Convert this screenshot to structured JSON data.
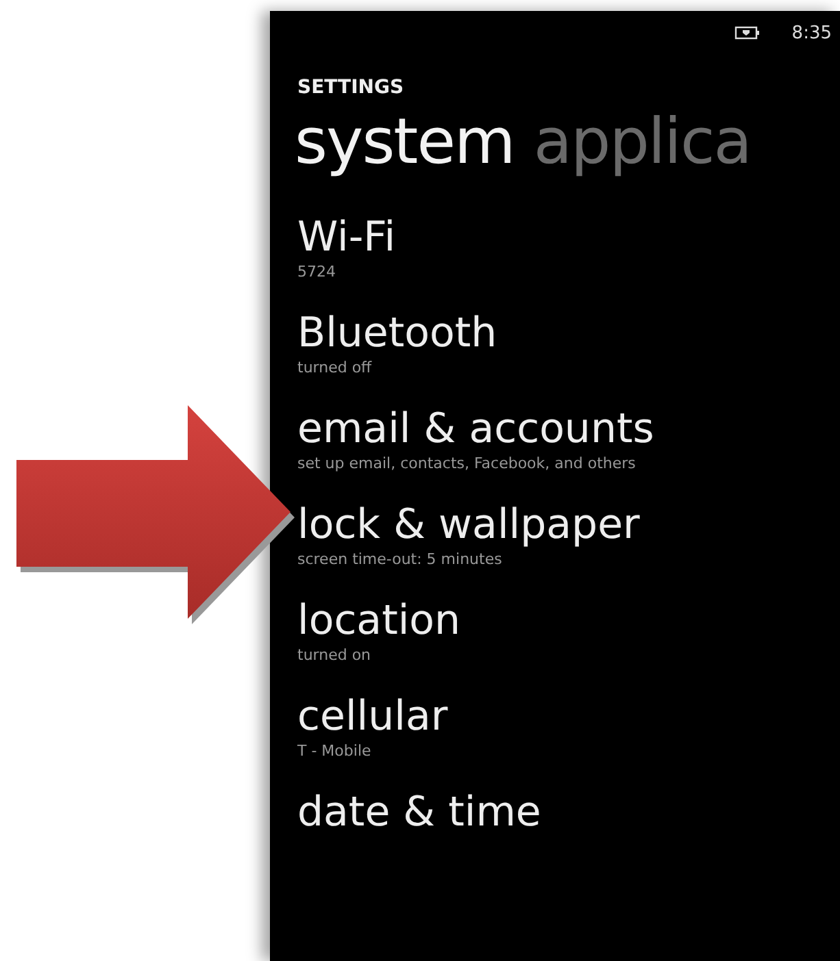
{
  "status_bar": {
    "time": "8:35"
  },
  "header": {
    "title": "SETTINGS"
  },
  "pivots": [
    {
      "label": "system",
      "selected": true
    },
    {
      "label": "applica",
      "selected": false
    }
  ],
  "items": [
    {
      "title": "Wi-Fi",
      "subtitle": "5724"
    },
    {
      "title": "Bluetooth",
      "subtitle": "turned off"
    },
    {
      "title": "email & accounts",
      "subtitle": "set up email, contacts, Facebook, and others"
    },
    {
      "title": "lock & wallpaper",
      "subtitle": "screen time-out: 5 minutes"
    },
    {
      "title": "location",
      "subtitle": "turned on"
    },
    {
      "title": "cellular",
      "subtitle": "T - Mobile"
    },
    {
      "title": "date & time"
    }
  ]
}
